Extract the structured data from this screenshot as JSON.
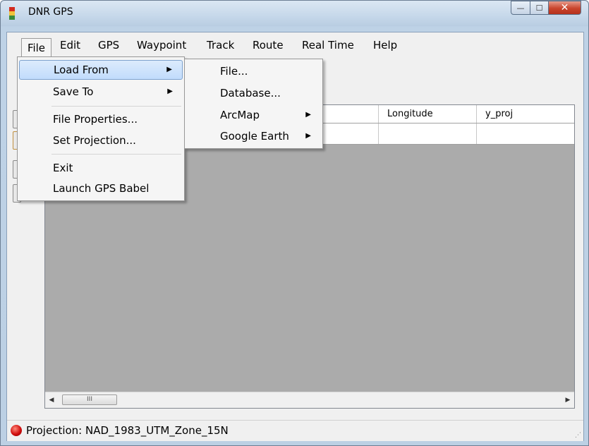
{
  "window": {
    "title": "DNR GPS",
    "minimize_glyph": "—",
    "maximize_glyph": "☐",
    "close_glyph": "✕"
  },
  "menubar": {
    "items": [
      "File",
      "Edit",
      "GPS",
      "Waypoint",
      "Track",
      "Route",
      "Real Time",
      "Help"
    ]
  },
  "file_menu": {
    "items": [
      {
        "label": "Load From",
        "has_submenu": true,
        "highlighted": true
      },
      {
        "label": "Save To",
        "has_submenu": true
      },
      {
        "label": "File Properties..."
      },
      {
        "label": "Set Projection..."
      },
      {
        "label": "Exit"
      },
      {
        "label": "Launch GPS Babel"
      }
    ]
  },
  "load_from_menu": {
    "items": [
      {
        "label": "File..."
      },
      {
        "label": "Database..."
      },
      {
        "label": "ArcMap",
        "has_submenu": true
      },
      {
        "label": "Google Earth",
        "has_submenu": true
      }
    ]
  },
  "grid": {
    "visible_columns": [
      "Longitude",
      "y_proj"
    ]
  },
  "scrollbar": {
    "thumb_glyph": "III"
  },
  "status": {
    "text": "Projection: NAD_1983_UTM_Zone_15N",
    "indicator_color": "#d10e0e"
  },
  "colors": {
    "highlight": "#c1dcfc",
    "grid_background": "#ababab"
  }
}
